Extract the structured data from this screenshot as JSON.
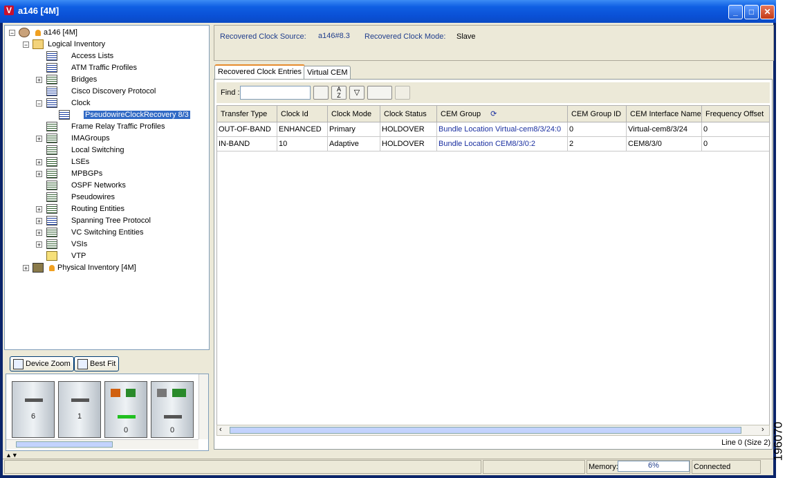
{
  "window": {
    "title": "a146 [4M]",
    "app_icon_letter": "V",
    "minimize_glyph": "_",
    "maximize_glyph": "□",
    "close_glyph": "✕"
  },
  "tree": {
    "root_label": "a146 [4M]",
    "logical_label": "Logical Inventory",
    "items": [
      {
        "label": "Access Lists"
      },
      {
        "label": "ATM Traffic Profiles"
      },
      {
        "label": "Bridges"
      },
      {
        "label": "Cisco Discovery Protocol"
      },
      {
        "label": "Clock"
      },
      {
        "label": "PseudowireClockRecovery 8/3"
      },
      {
        "label": "Frame Relay Traffic Profiles"
      },
      {
        "label": "IMAGroups"
      },
      {
        "label": "Local Switching"
      },
      {
        "label": "LSEs"
      },
      {
        "label": "MPBGPs"
      },
      {
        "label": "OSPF Networks"
      },
      {
        "label": "Pseudowires"
      },
      {
        "label": "Routing Entities"
      },
      {
        "label": "Spanning Tree Protocol"
      },
      {
        "label": "VC Switching Entities"
      },
      {
        "label": "VSIs"
      },
      {
        "label": "VTP"
      }
    ],
    "physical_label": "Physical Inventory [4M]"
  },
  "device_toolbar": {
    "zoom_label": "Device Zoom",
    "fit_label": "Best Fit"
  },
  "device_slots": [
    "6",
    "1",
    "0",
    "0"
  ],
  "info": {
    "source_label": "Recovered Clock Source:",
    "source_value": "a146#8.3",
    "mode_label": "Recovered Clock Mode:",
    "mode_value": "Slave"
  },
  "tabs": [
    {
      "label": "Recovered Clock Entries"
    },
    {
      "label": "Virtual CEM"
    }
  ],
  "find": {
    "label": "Find :",
    "value": ""
  },
  "table": {
    "columns": [
      "Transfer Type",
      "Clock Id",
      "Clock Mode",
      "Clock Status",
      "CEM Group",
      "CEM Group ID",
      "CEM Interface Name",
      "Frequency Offset"
    ],
    "rows": [
      [
        "OUT-OF-BAND",
        "ENHANCED",
        "Primary",
        "HOLDOVER",
        "Bundle Location Virtual-cem8/3/24:0",
        "0",
        "Virtual-cem8/3/24",
        "0"
      ],
      [
        "IN-BAND",
        "10",
        "Adaptive",
        "HOLDOVER",
        "Bundle Location CEM8/3/0:2",
        "2",
        "CEM8/3/0",
        "0"
      ]
    ],
    "status": "Line 0 (Size 2)"
  },
  "statusbar": {
    "memory_label": "Memory:",
    "memory_value": "6%",
    "connection": "Connected"
  },
  "figure_id": "196070"
}
